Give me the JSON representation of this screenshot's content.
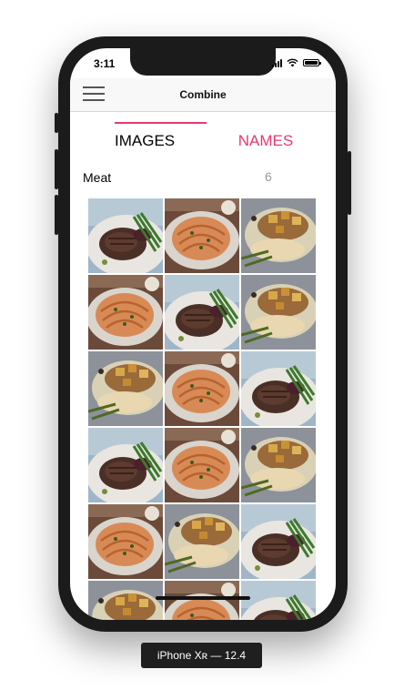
{
  "status_bar": {
    "time": "3:11"
  },
  "nav": {
    "title": "Combine"
  },
  "tabs": [
    {
      "label": "IMAGES",
      "selected": true
    },
    {
      "label": "NAMES",
      "selected": false
    }
  ],
  "colors": {
    "accent": "#e8386d",
    "selected_text": "#000000"
  },
  "section": {
    "title": "Meat",
    "count": "6"
  },
  "grid": {
    "cells": [
      {
        "dish": "steak-asparagus"
      },
      {
        "dish": "roast-chicken"
      },
      {
        "dish": "pork-potatoes"
      },
      {
        "dish": "roast-chicken"
      },
      {
        "dish": "steak-asparagus"
      },
      {
        "dish": "pork-potatoes"
      },
      {
        "dish": "pork-potatoes"
      },
      {
        "dish": "roast-chicken"
      },
      {
        "dish": "steak-asparagus"
      },
      {
        "dish": "steak-asparagus"
      },
      {
        "dish": "roast-chicken"
      },
      {
        "dish": "pork-potatoes"
      },
      {
        "dish": "roast-chicken"
      },
      {
        "dish": "pork-potatoes"
      },
      {
        "dish": "steak-asparagus"
      },
      {
        "dish": "pork-potatoes"
      },
      {
        "dish": "roast-chicken"
      },
      {
        "dish": "steak-asparagus"
      }
    ]
  },
  "device_label": "iPhone Xʀ — 12.4"
}
